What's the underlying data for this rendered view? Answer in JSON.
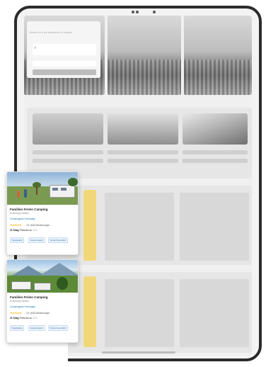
{
  "search": {
    "hint": "Search for a trip destination or location"
  },
  "cards": [
    {
      "title": "Familien Ferien Camping",
      "location": "Schleswig-Holstein",
      "link": "Campingplatz Homepage",
      "stars": "★★★★★",
      "rating": "4.5",
      "reviews": "(842) Bewertungen",
      "price_bold": "31 €/tag",
      "price_text": "Preis bis zu",
      "price_muted": "45 €",
      "tags": [
        "Strandnähe",
        "Hunde erlaubt",
        "Kinder Freundlich"
      ]
    },
    {
      "title": "Familien Ferien Camping",
      "location": "Schleswig-Holstein",
      "link": "Campingplatz Homepage",
      "stars": "★★★★★",
      "rating": "4.5",
      "reviews": "(842) Bewertungen",
      "price_bold": "31 €/tag",
      "price_text": "Preis bis zu",
      "price_muted": "45 €",
      "tags": [
        "Strandnähe",
        "Hunde erlaubt",
        "Kinder Freundlich"
      ]
    }
  ]
}
